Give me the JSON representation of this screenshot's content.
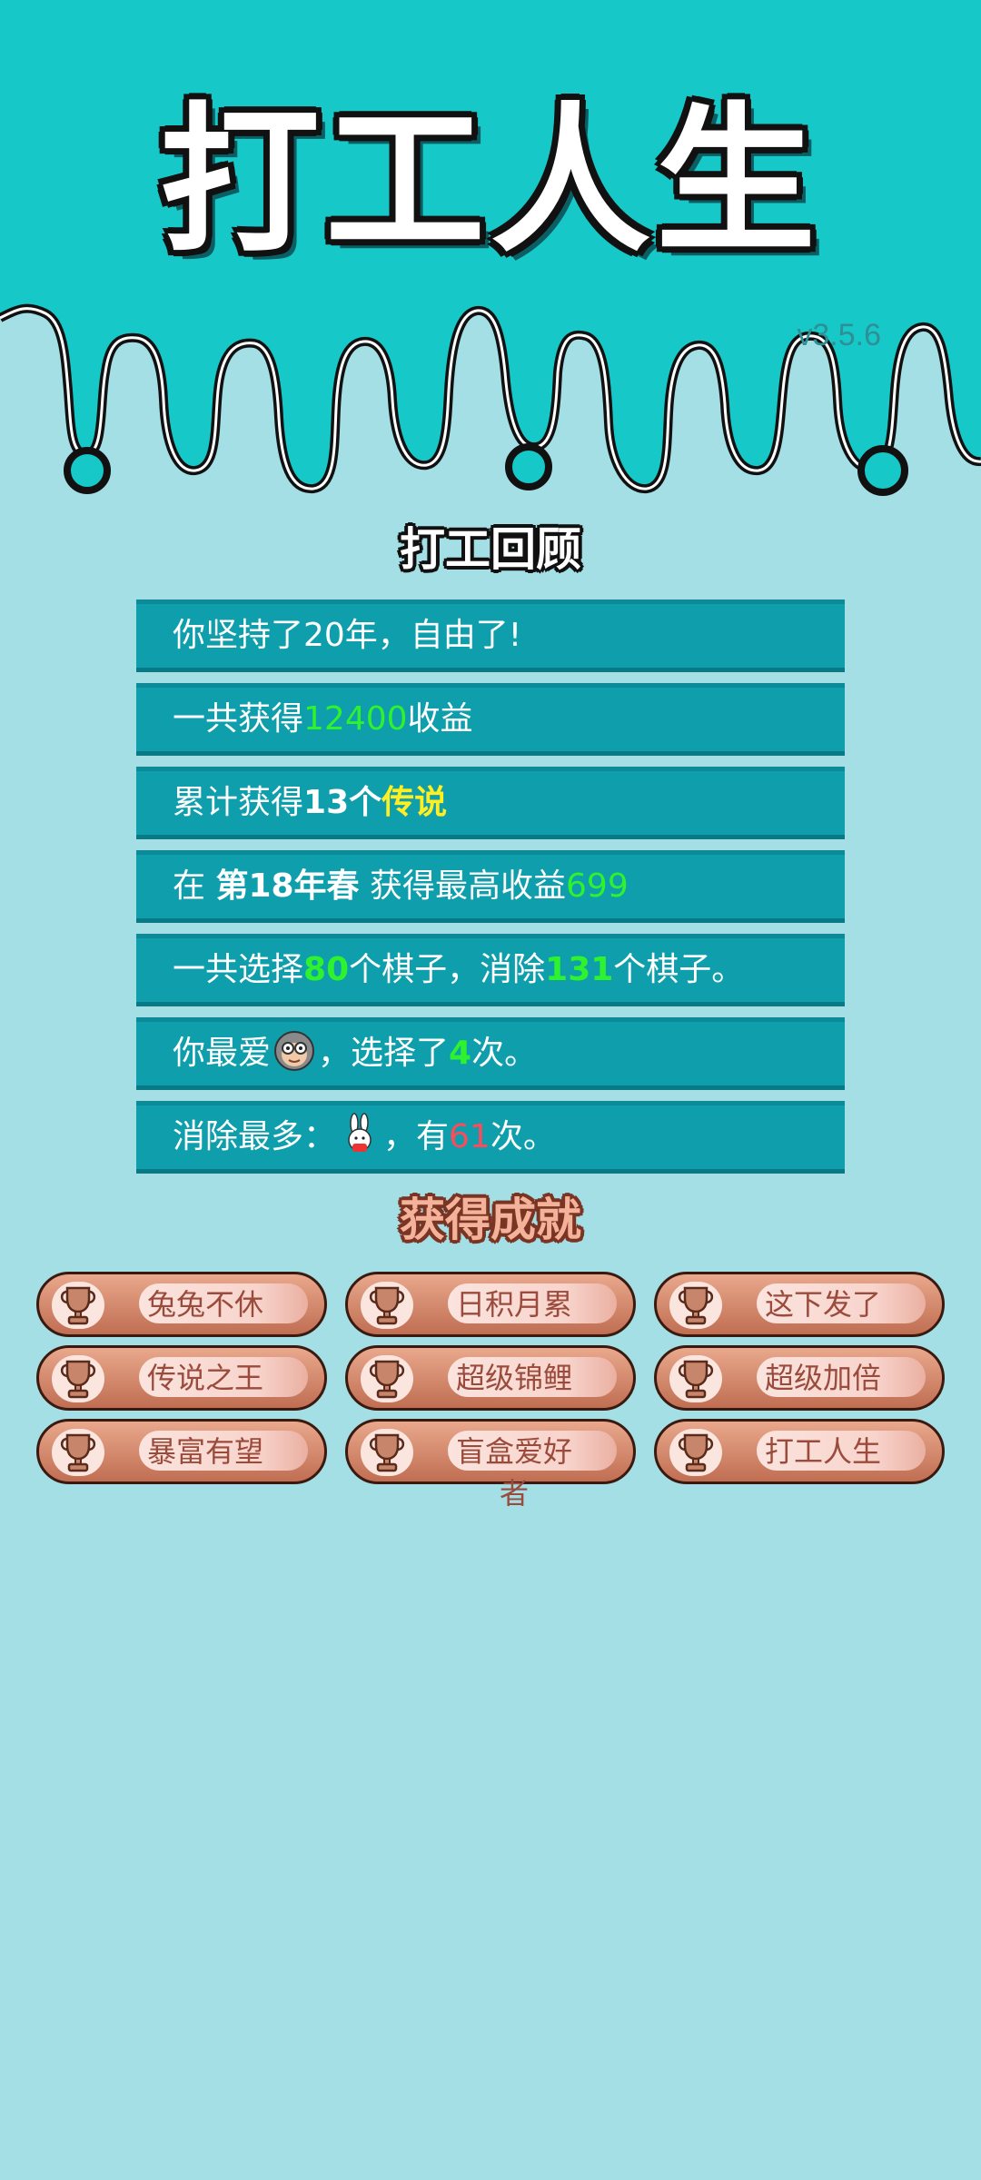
{
  "app": {
    "title": "打工人生",
    "version": "v3.5.6"
  },
  "review": {
    "title": "打工回顾",
    "rows": {
      "years": {
        "pre": "你坚持了20年，自由了!"
      },
      "income": {
        "pre": "一共获得",
        "value": "12400",
        "post": "收益"
      },
      "legend": {
        "pre": "累计获得",
        "count": "13个",
        "tag": "传说"
      },
      "best": {
        "pre": "在 ",
        "season": "第18年春",
        "mid": " 获得最高收益",
        "value": "699"
      },
      "pieces": {
        "pre": "一共选择",
        "chosen": "80",
        "mid": "个棋子，消除",
        "removed": "131",
        "post": "个棋子。"
      },
      "favorite": {
        "pre": "你最爱",
        "icon": "monkey-icon",
        "mid": "，选择了",
        "count": "4",
        "post": "次。"
      },
      "most_removed": {
        "pre": "消除最多：",
        "icon": "rabbit-icon",
        "mid": "，有",
        "count": "61",
        "post": "次。"
      }
    }
  },
  "achievements": {
    "title": "获得成就",
    "items": [
      {
        "label": "兔兔不休"
      },
      {
        "label": "日积月累"
      },
      {
        "label": "这下发了"
      },
      {
        "label": "传说之王"
      },
      {
        "label": "超级锦鲤"
      },
      {
        "label": "超级加倍"
      },
      {
        "label": "暴富有望"
      },
      {
        "label": "盲盒爱好者"
      },
      {
        "label": "打工人生"
      }
    ]
  },
  "colors": {
    "header": "#16c8c8",
    "background": "#a3dfe5",
    "row": "#0e9eac",
    "green": "#2ff22f",
    "yellow": "#ffee22",
    "red": "#ff4a5a"
  }
}
